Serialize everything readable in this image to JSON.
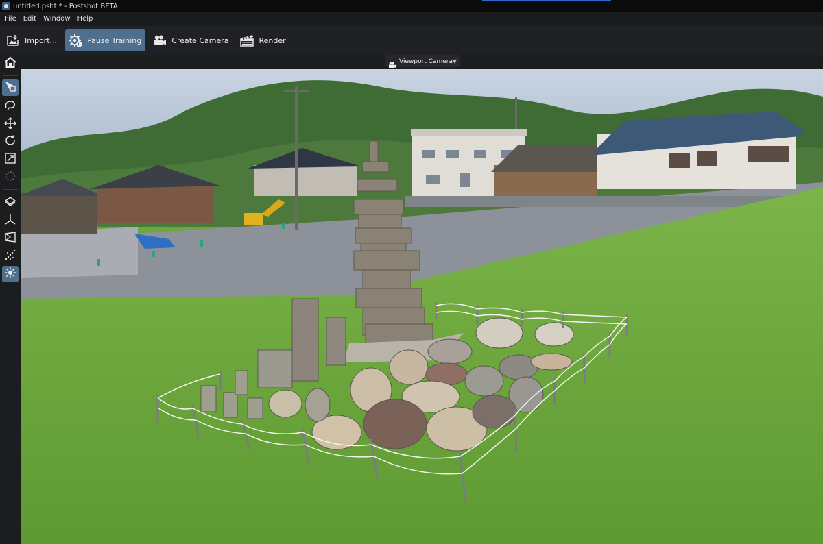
{
  "window": {
    "title": "untitled.psht * - Postshot BETA"
  },
  "menu": {
    "items": [
      "File",
      "Edit",
      "Window",
      "Help"
    ]
  },
  "toolbar": {
    "import_label": "Import...",
    "pause_label": "Pause Training",
    "create_camera_label": "Create Camera",
    "render_label": "Render"
  },
  "viewport": {
    "camera_label": "Viewport Camera",
    "camera_icon": "camera-icon"
  },
  "sidebar": {
    "tools": [
      "home-icon",
      "select-icon",
      "lasso-icon",
      "move-icon",
      "rotate-icon",
      "scale-icon",
      "brush-icon",
      "layers-icon",
      "axis-icon",
      "camera-frustum-icon",
      "points-icon",
      "splat-icon"
    ]
  },
  "colors": {
    "accent": "#4f6f8f",
    "titlebar": "#0b0b0c",
    "background": "#1b1c1e"
  }
}
